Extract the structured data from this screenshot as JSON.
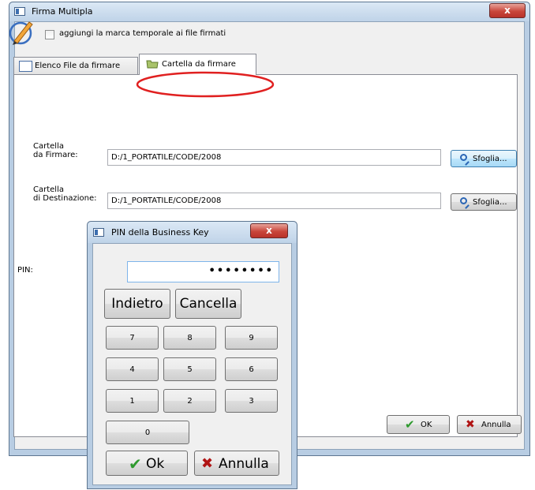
{
  "main_window": {
    "title": "Firma Multipla",
    "close_label": "x",
    "timestamp_checkbox": {
      "label": "aggiungi la marca temporale ai file firmati",
      "checked": false
    },
    "tabs": [
      {
        "label": "Elenco File da firmare",
        "selected": false
      },
      {
        "label": "Cartella da firmare",
        "selected": true
      }
    ],
    "source_folder": {
      "label_line1": "Cartella",
      "label_line2": "da Firmare:",
      "value": "D:/1_PORTATILE/CODE/2008",
      "browse_label": "Sfoglia..."
    },
    "destination_folder": {
      "label_line1": "Cartella",
      "label_line2": "di Destinazione:",
      "value": "D:/1_PORTATILE/CODE/2008",
      "browse_label": "Sfoglia..."
    },
    "ok_label": "OK",
    "cancel_label": "Annulla"
  },
  "pin_dialog": {
    "title": "PIN della Business Key",
    "close_label": "x",
    "pin_label": "PIN:",
    "pin_value": "••••••••",
    "back_label": "Indietro",
    "clear_label": "Cancella",
    "keys": [
      "7",
      "8",
      "9",
      "4",
      "5",
      "6",
      "1",
      "2",
      "3",
      "0"
    ],
    "ok_label": "Ok",
    "cancel_label": "Annulla"
  },
  "colors": {
    "annotation": "#e02020",
    "accent_blue": "#3c7fb1",
    "ok_green": "#2e9a2e",
    "cancel_red": "#b01414"
  }
}
